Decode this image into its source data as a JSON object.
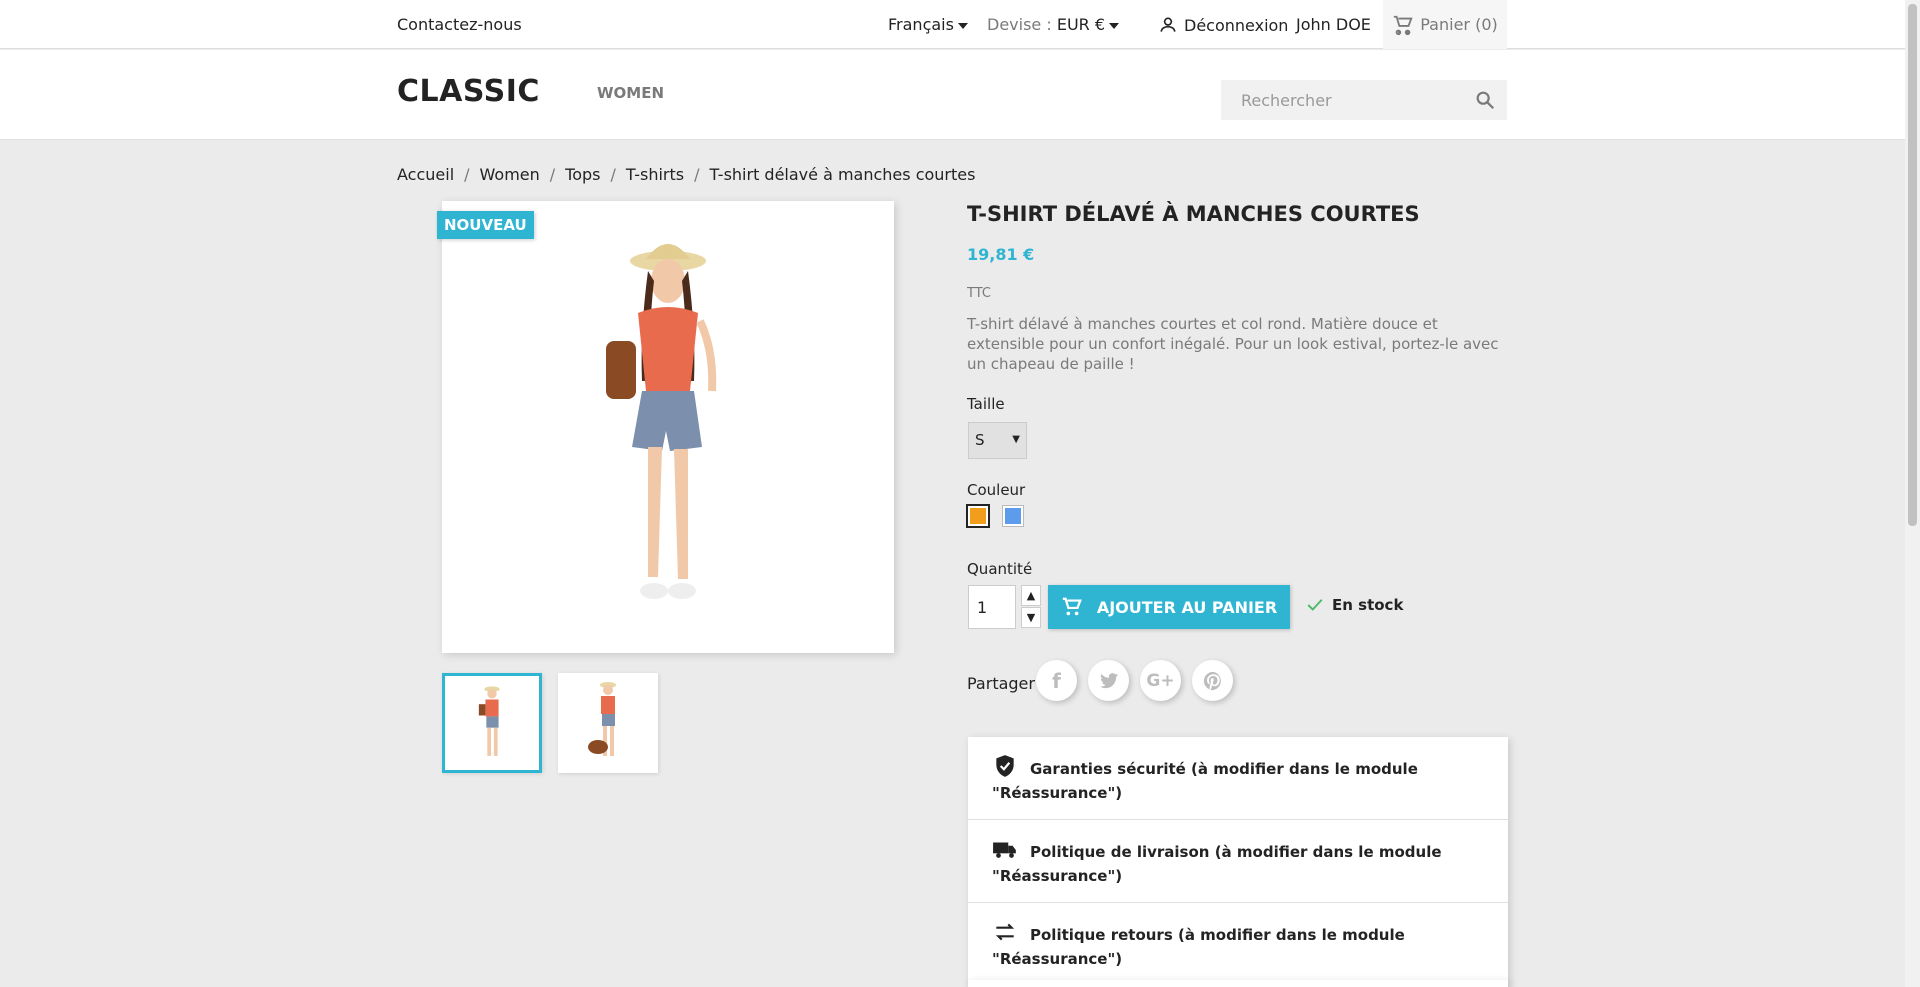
{
  "topbar": {
    "contact": "Contactez-nous",
    "language": "Français",
    "currency_label": "Devise :",
    "currency_value": "EUR €",
    "logout": "Déconnexion",
    "user": "John DOE",
    "cart": "Panier (0)"
  },
  "header": {
    "logo": "CLASSIC",
    "nav": [
      "WOMEN"
    ],
    "search_placeholder": "Rechercher"
  },
  "breadcrumb": [
    "Accueil",
    "Women",
    "Tops",
    "T-shirts",
    "T-shirt délavé à manches courtes"
  ],
  "product": {
    "badge": "NOUVEAU",
    "title": "T-shirt délavé à manches courtes",
    "price": "19,81 €",
    "tax": "TTC",
    "description": "T-shirt délavé à manches courtes et col rond. Matière douce et extensible pour un confort inégalé. Pour un look estival, portez-le avec un chapeau de paille !",
    "size_label": "Taille",
    "size_value": "S",
    "color_label": "Couleur",
    "colors": [
      "#f39d1c",
      "#5d9cec"
    ],
    "quantity_label": "Quantité",
    "quantity": "1",
    "add_to_cart": "AJOUTER AU PANIER",
    "stock": "En stock",
    "share_label": "Partager",
    "share_icons": [
      "facebook-icon",
      "twitter-icon",
      "google-plus-icon",
      "pinterest-icon"
    ]
  },
  "reassurance": [
    "Garanties sécurité (à modifier dans le module \"Réassurance\")",
    "Politique de livraison (à modifier dans le module \"Réassurance\")",
    "Politique retours (à modifier dans le module \"Réassurance\")"
  ],
  "colors": {
    "accent": "#2fb5d2"
  }
}
